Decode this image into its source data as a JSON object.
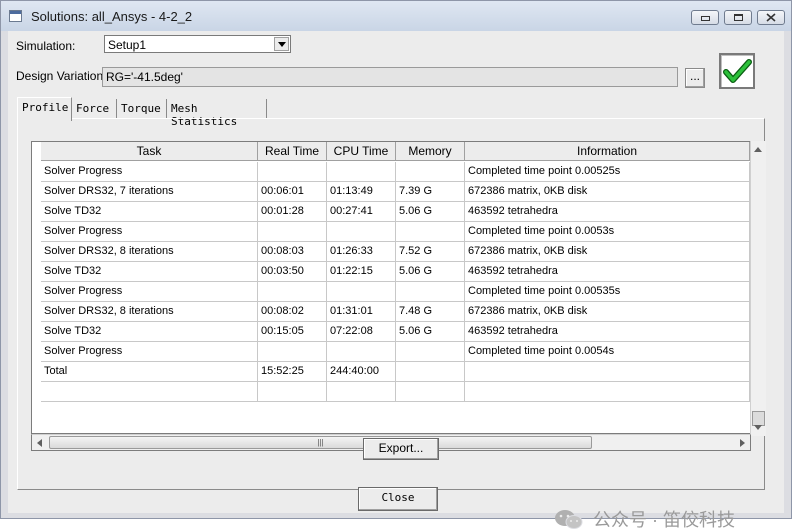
{
  "window": {
    "title": "Solutions: all_Ansys - 4-2_2",
    "minimize_icon": "minimize-icon",
    "maximize_icon": "maximize-icon",
    "close_icon": "close-icon"
  },
  "form": {
    "simulation_label": "Simulation:",
    "simulation_value": "Setup1",
    "design_variation_label": "Design Variation:",
    "design_variation_value": "RG='-41.5deg'",
    "browse_label": "...",
    "status_icon": "green-checkmark-icon",
    "status_color": "#1fa32c"
  },
  "tabs": [
    {
      "label": "Profile",
      "active": true
    },
    {
      "label": "Force",
      "active": false
    },
    {
      "label": "Torque",
      "active": false
    },
    {
      "label": "Mesh Statistics",
      "active": false
    }
  ],
  "table": {
    "columns": [
      "Task",
      "Real Time",
      "CPU Time",
      "Memory",
      "Information"
    ],
    "rows": [
      [
        "Solver Progress",
        "",
        "",
        "",
        "Completed time point 0.00525s"
      ],
      [
        "Solver DRS32, 7 iterations",
        "00:06:01",
        "01:13:49",
        "7.39 G",
        "672386 matrix,  0KB disk"
      ],
      [
        "Solve TD32",
        "00:01:28",
        "00:27:41",
        "5.06 G",
        "463592 tetrahedra"
      ],
      [
        "Solver Progress",
        "",
        "",
        "",
        "Completed time point 0.0053s"
      ],
      [
        "Solver DRS32, 8 iterations",
        "00:08:03",
        "01:26:33",
        "7.52 G",
        "672386 matrix,  0KB disk"
      ],
      [
        "Solve TD32",
        "00:03:50",
        "01:22:15",
        "5.06 G",
        "463592 tetrahedra"
      ],
      [
        "Solver Progress",
        "",
        "",
        "",
        "Completed time point 0.00535s"
      ],
      [
        "Solver DRS32, 8 iterations",
        "00:08:02",
        "01:31:01",
        "7.48 G",
        "672386 matrix,  0KB disk"
      ],
      [
        "Solve TD32",
        "00:15:05",
        "07:22:08",
        "5.06 G",
        "463592 tetrahedra"
      ],
      [
        "Solver Progress",
        "",
        "",
        "",
        "Completed time point 0.0054s"
      ],
      [
        "Total",
        "15:52:25",
        "244:40:00",
        "",
        ""
      ]
    ]
  },
  "buttons": {
    "export": "Export...",
    "close": "Close"
  },
  "watermark": {
    "text": "公众号 · 笛佼科技",
    "icon": "wechat-icon"
  }
}
